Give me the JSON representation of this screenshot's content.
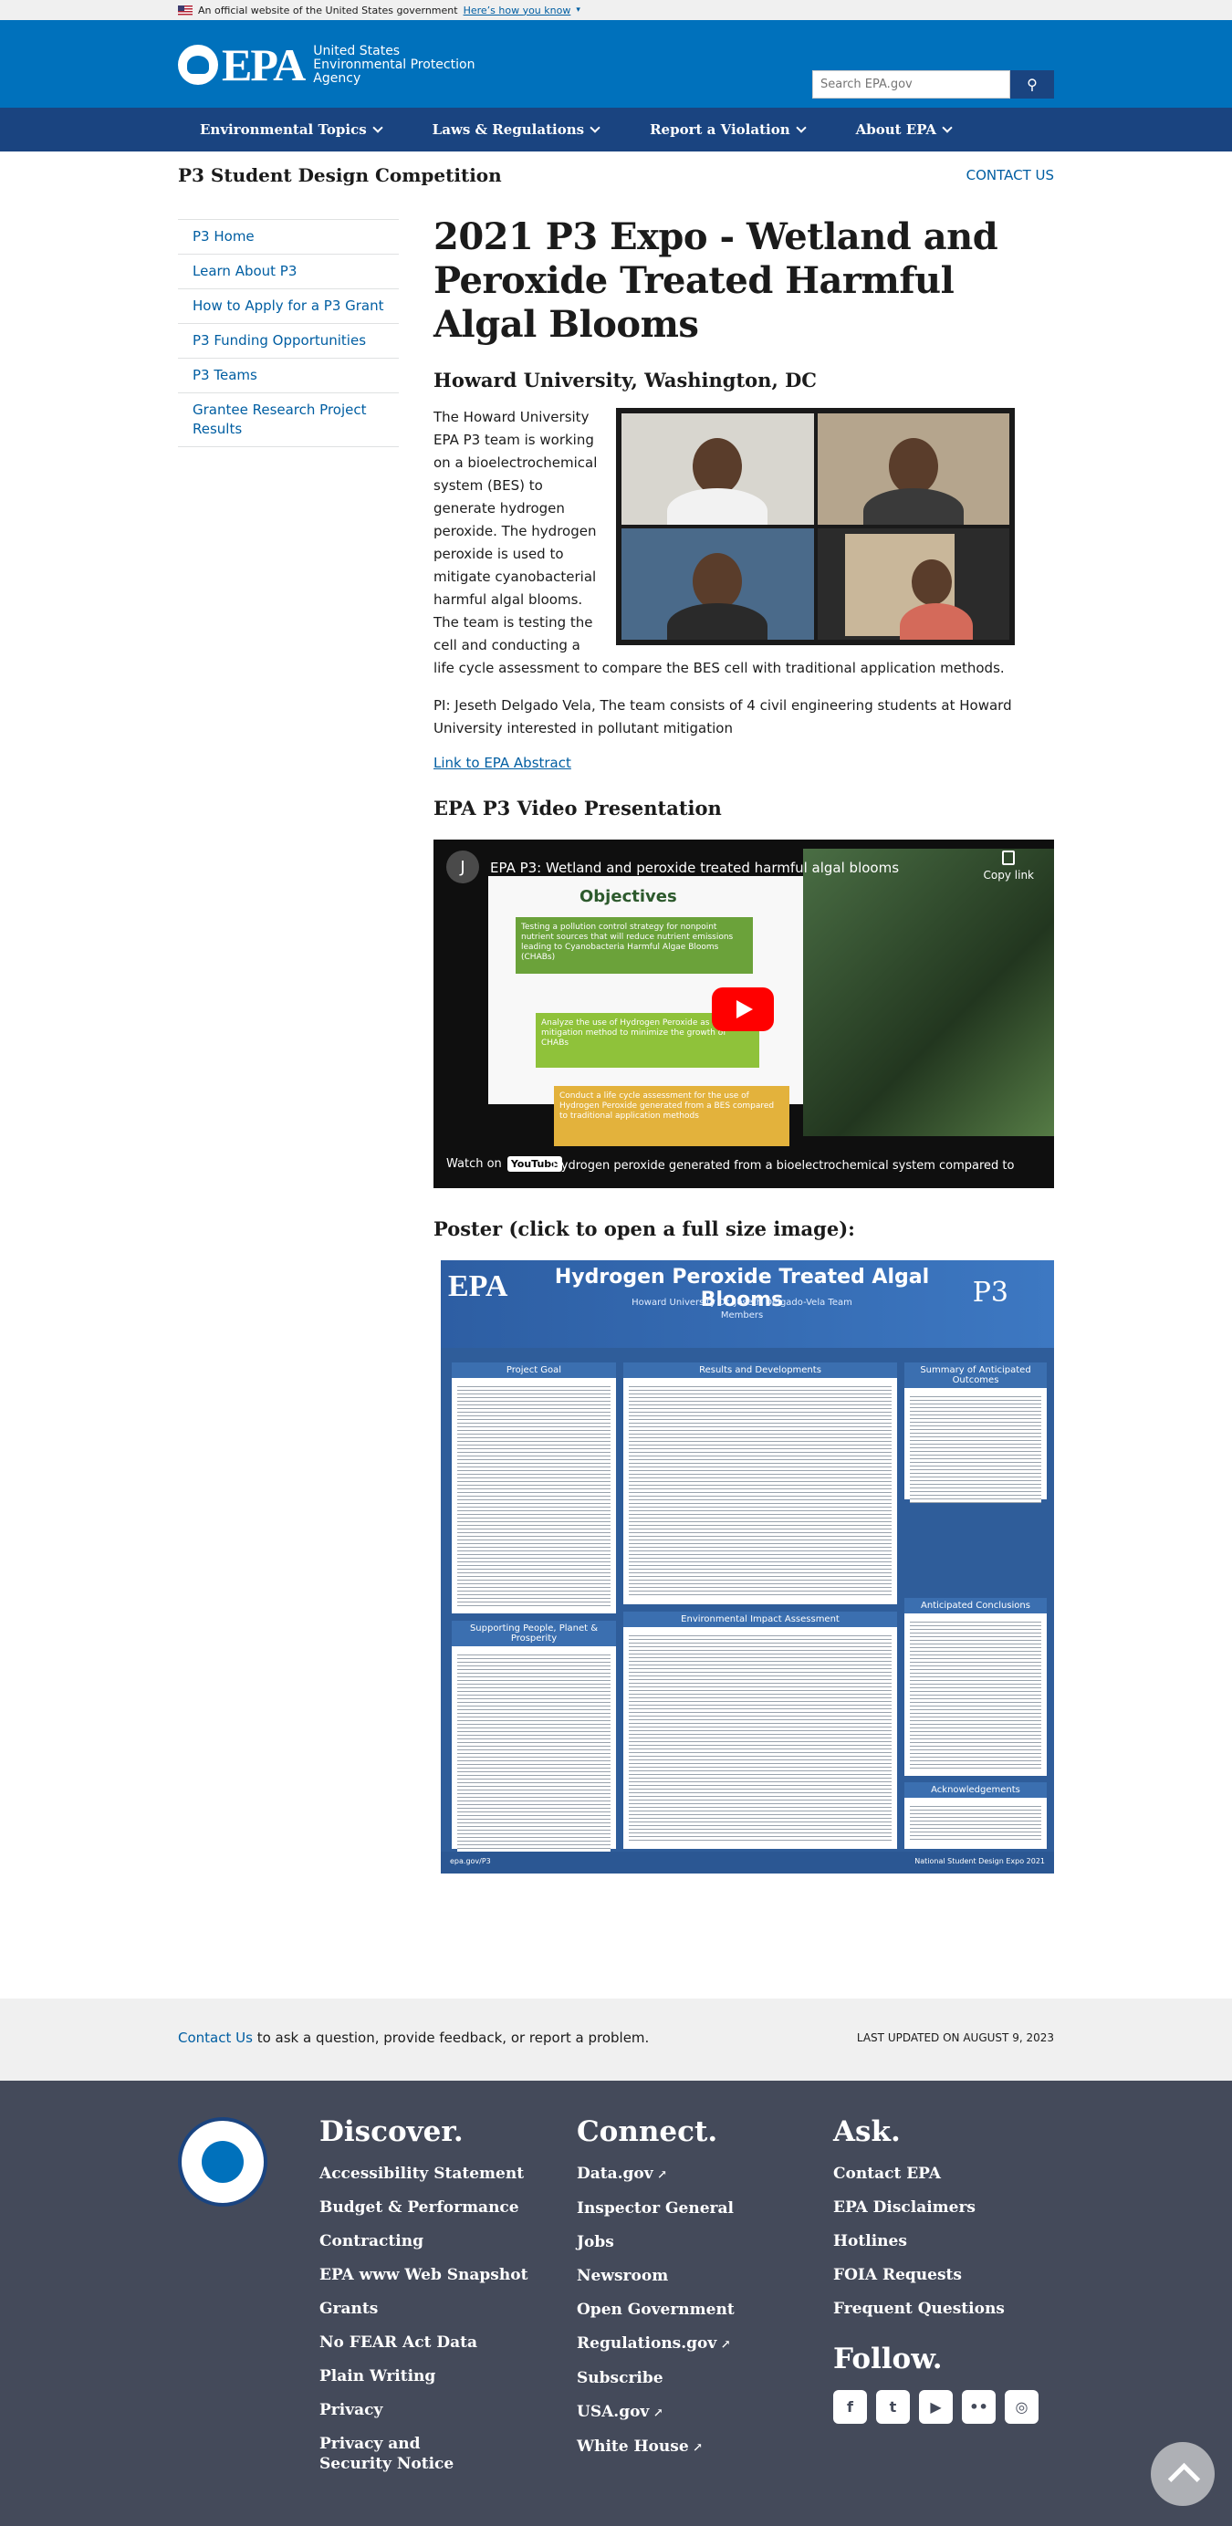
{
  "banner": {
    "text": "An official website of the United States government",
    "how": "Here’s how you know"
  },
  "header": {
    "logo_text": "EPA",
    "agency": "United States Environmental Protection Agency",
    "search_placeholder": "Search EPA.gov"
  },
  "nav": [
    {
      "label": "Environmental Topics"
    },
    {
      "label": "Laws & Regulations"
    },
    {
      "label": "Report a Violation"
    },
    {
      "label": "About EPA"
    }
  ],
  "site": {
    "title": "P3 Student Design Competition",
    "contact": "CONTACT US"
  },
  "sidebar": [
    {
      "label": "P3 Home"
    },
    {
      "label": "Learn About P3"
    },
    {
      "label": "How to Apply for a P3 Grant"
    },
    {
      "label": "P3 Funding Opportunities"
    },
    {
      "label": "P3 Teams"
    },
    {
      "label": "Grantee Research Project Results"
    }
  ],
  "main": {
    "title": "2021 P3 Expo - Wetland and Peroxide Treated Harmful Algal Blooms",
    "subtitle": "Howard University, Washington, DC",
    "intro": "The Howard University EPA P3 team is working on a bioelectrochemical system (BES) to generate hydrogen peroxide. The hydrogen peroxide is used to mitigate cyanobacterial harmful algal blooms. The team is testing the cell and conducting a life cycle assessment to compare the BES cell with traditional application methods.",
    "pi": "PI: Jeseth Delgado Vela, The team consists of 4 civil engineering students at Howard University interested in pollutant mitigation",
    "abstract_link": "Link to EPA Abstract",
    "video_heading": "EPA P3 Video Presentation",
    "poster_heading": "Poster (click to open a full size image):"
  },
  "video": {
    "avatar": "J",
    "title": "EPA P3: Wetland and peroxide treated harmful algal blooms",
    "copy": "Copy link",
    "slide_title": "Objectives",
    "box1": "Testing a pollution control strategy for nonpoint nutrient sources that will reduce nutrient emissions leading to Cyanobacteria Harmful Algae Blooms (CHABs)",
    "box2": "Analyze the use of Hydrogen Peroxide as a mitigation method to minimize the growth of CHABs",
    "box3": "Conduct a life cycle assessment for the use of Hydrogen Peroxide generated from a BES compared to traditional application methods",
    "watch_on": "Watch on",
    "yt": "YouTube",
    "caption": "Hydrogen peroxide generated from a bioelectrochemical system compared to"
  },
  "poster": {
    "epa": "EPA",
    "title": "Hydrogen Peroxide Treated Algal Blooms",
    "sub": "Howard University Dr. Jeseth Delgado-Vela Team Members",
    "p3": "P3",
    "sections": [
      "Project Goal",
      "Results and Developments",
      "Summary of Anticipated Outcomes",
      "Supporting People, Planet & Prosperity",
      "Environmental Impact Assessment",
      "Anticipated Conclusions",
      "Acknowledgements"
    ],
    "foot_left": "epa.gov/P3",
    "foot_right": "National Student Design Expo 2021"
  },
  "footer": {
    "ask_link": "Contact Us",
    "ask_rest": " to ask a question, provide feedback, or report a problem.",
    "last_updated": "LAST UPDATED ON AUGUST 9, 2023",
    "discover_title": "Discover.",
    "discover": [
      "Accessibility Statement",
      "Budget & Performance",
      "Contracting",
      "EPA www Web Snapshot",
      "Grants",
      "No FEAR Act Data",
      "Plain Writing",
      "Privacy",
      "Privacy and Security Notice"
    ],
    "connect_title": "Connect.",
    "connect": [
      "Data.gov",
      "Inspector General",
      "Jobs",
      "Newsroom",
      "Open Government",
      "Regulations.gov",
      "Subscribe",
      "USA.gov",
      "White House"
    ],
    "ask_title": "Ask.",
    "ask": [
      "Contact EPA",
      "EPA Disclaimers",
      "Hotlines",
      "FOIA Requests",
      "Frequent Questions"
    ],
    "follow_title": "Follow.",
    "social": [
      "f",
      "t",
      "▶",
      "••",
      "◎"
    ]
  }
}
